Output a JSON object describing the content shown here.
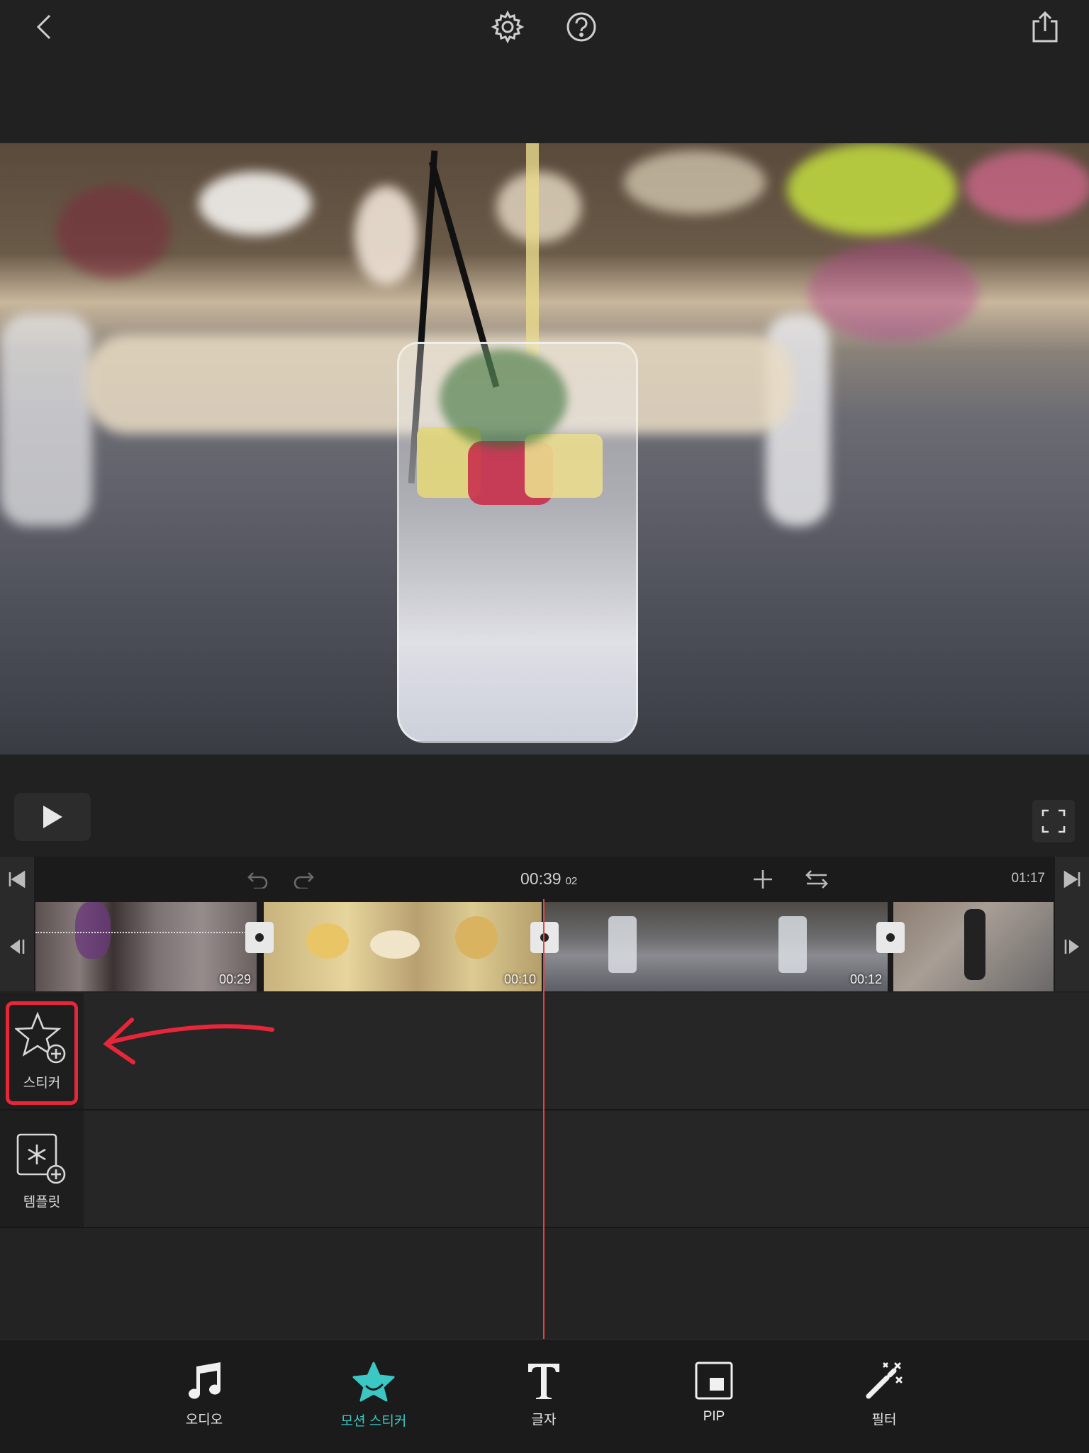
{
  "app": {
    "accent_color": "#3bc7c4",
    "playhead_color": "#e0453f",
    "highlight_color": "#e8263a"
  },
  "topbar": {
    "back_icon": "chevron-left-icon",
    "settings_icon": "gear-icon",
    "help_icon": "question-icon",
    "share_icon": "share-icon"
  },
  "timeline": {
    "current_time": "00:39",
    "current_frames": "02",
    "total_time": "01:17",
    "clips": [
      {
        "duration": "00:29"
      },
      {
        "duration": "00:10"
      },
      {
        "duration": "00:12"
      },
      {
        "duration": ""
      }
    ]
  },
  "tracks": {
    "sticker_label": "스티커",
    "template_label": "템플릿"
  },
  "toolbar": {
    "items": [
      {
        "label": "오디오",
        "icon": "music-note-icon"
      },
      {
        "label": "모션 스티커",
        "icon": "star-icon",
        "active": true
      },
      {
        "label": "글자",
        "icon": "text-icon"
      },
      {
        "label": "PIP",
        "icon": "pip-icon"
      },
      {
        "label": "필터",
        "icon": "magic-wand-icon"
      }
    ]
  }
}
